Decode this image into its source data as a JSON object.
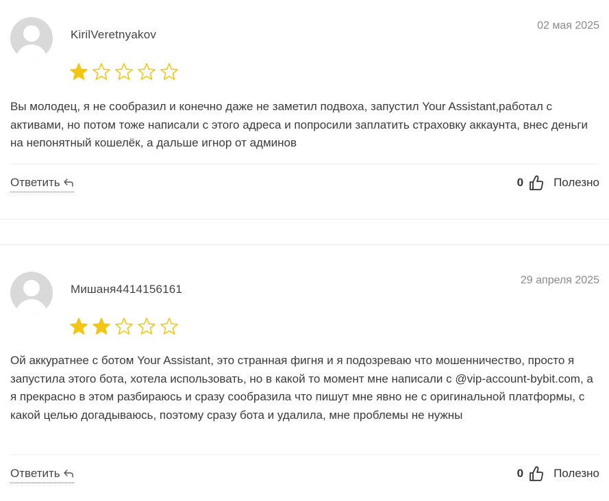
{
  "colors": {
    "star_filled": "#f2c713",
    "star_outline": "#f2c713",
    "divider": "#eeeeee"
  },
  "icons": {
    "avatar": "user-avatar-placeholder",
    "star": "star-icon",
    "reply": "reply-arrow-icon",
    "thumb": "thumbs-up-icon"
  },
  "reviews": [
    {
      "author": "KirilVeretnyakov",
      "date": "02 мая 2025",
      "rating": 1,
      "rating_max": 5,
      "text": "Вы молодец, я не сообразил и конечно даже не заметил подвоха, запустил Your Assistant,работал с активами, но потом тоже написали с этого адреса и попросили заплатить страховку аккаунта, внес деньги на непонятный кошелёк, а дальше игнор от админов",
      "reply_label": "Ответить",
      "helpful_count": "0",
      "helpful_label": "Полезно"
    },
    {
      "author": "Мишаня4414156161",
      "date": "29 апреля 2025",
      "rating": 2,
      "rating_max": 5,
      "text": "Ой аккуратнее с ботом Your Assistant, это странная фигня и я подозреваю что мошенничество, просто я запустила этого бота, хотела использовать, но в какой то момент мне написали с @vip-account-bybit.com, а я прекрасно в этом разбираюсь и сразу сообразила что пишут мне явно не с оригинальной платформы, с какой целью догадываюсь, поэтому сразу бота и удалила, мне проблемы не нужны",
      "reply_label": "Ответить",
      "helpful_count": "0",
      "helpful_label": "Полезно"
    }
  ]
}
